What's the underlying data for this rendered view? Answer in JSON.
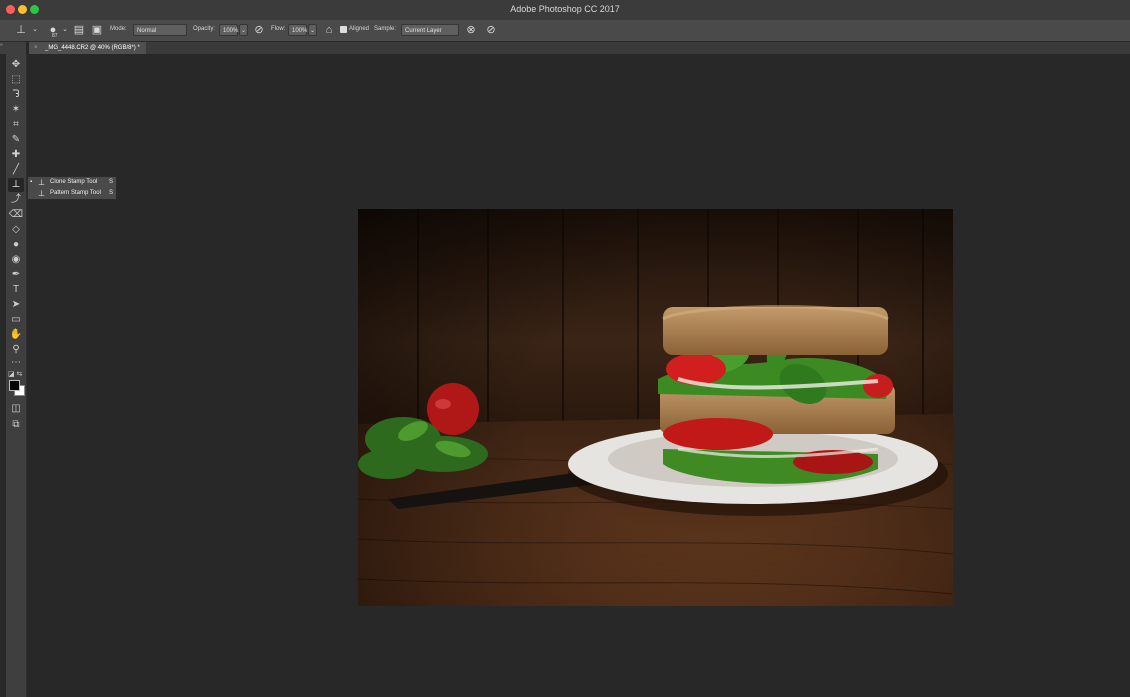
{
  "window": {
    "title": "Adobe Photoshop CC 2017"
  },
  "options_bar": {
    "brush_size": "87",
    "mode_label": "Mode:",
    "mode_value": "Normal",
    "opacity_label": "Opacity:",
    "opacity_value": "100%",
    "flow_label": "Flow:",
    "flow_value": "100%",
    "aligned_label": "Aligned",
    "aligned_checked": true,
    "sample_label": "Sample:",
    "sample_value": "Current Layer"
  },
  "document_tab": {
    "label": "_MG_4448.CR2 @ 40% (RGB/8*) *",
    "close": "×"
  },
  "tools": [
    {
      "name": "move-tool",
      "glyph": "✥"
    },
    {
      "name": "marquee-tool",
      "glyph": "⬚"
    },
    {
      "name": "lasso-tool",
      "glyph": "ᘊ"
    },
    {
      "name": "magic-wand-tool",
      "glyph": "✶"
    },
    {
      "name": "crop-tool",
      "glyph": "⌗"
    },
    {
      "name": "eyedropper-tool",
      "glyph": "✎"
    },
    {
      "name": "healing-brush-tool",
      "glyph": "✚"
    },
    {
      "name": "brush-tool",
      "glyph": "╱"
    },
    {
      "name": "clone-stamp-tool",
      "glyph": "⊥",
      "active": true
    },
    {
      "name": "history-brush-tool",
      "glyph": "⤴"
    },
    {
      "name": "eraser-tool",
      "glyph": "⌫"
    },
    {
      "name": "paint-bucket-tool",
      "glyph": "◇"
    },
    {
      "name": "blur-tool",
      "glyph": "●"
    },
    {
      "name": "dodge-tool",
      "glyph": "◉"
    },
    {
      "name": "pen-tool",
      "glyph": "✒"
    },
    {
      "name": "type-tool",
      "glyph": "T"
    },
    {
      "name": "path-selection-tool",
      "glyph": "➤"
    },
    {
      "name": "rectangle-tool",
      "glyph": "▭"
    },
    {
      "name": "hand-tool",
      "glyph": "✋"
    },
    {
      "name": "zoom-tool",
      "glyph": "⚲"
    },
    {
      "name": "edit-toolbar",
      "glyph": "⋯"
    }
  ],
  "flyout": {
    "items": [
      {
        "label": "Clone Stamp Tool",
        "key": "S",
        "selected": true
      },
      {
        "label": "Pattern Stamp Tool",
        "key": "S",
        "selected": false
      }
    ]
  }
}
